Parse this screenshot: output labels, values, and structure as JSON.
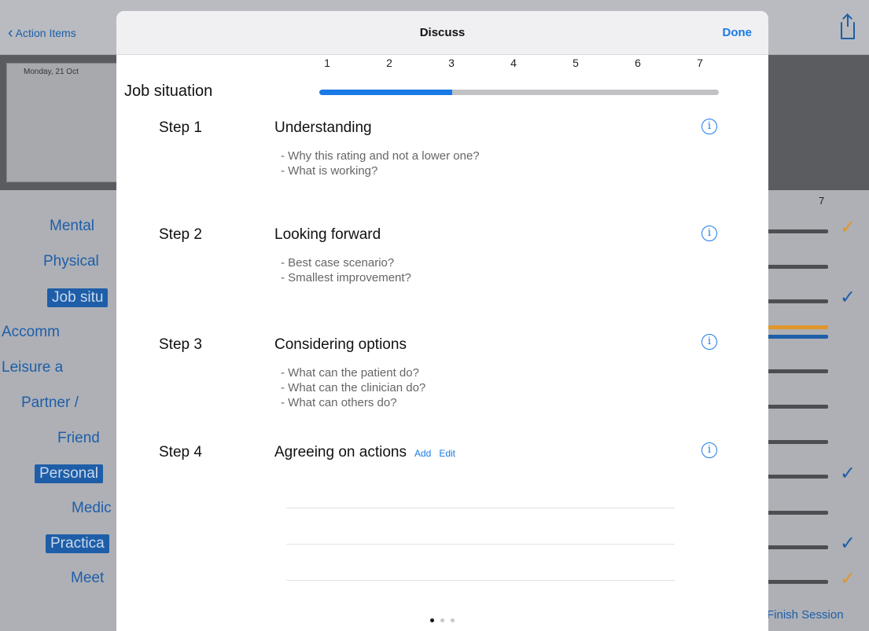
{
  "background": {
    "back_label": "Action Items",
    "date": "Monday, 21 Oct",
    "scale_top_label": "7",
    "finish_label": "Finish Session",
    "categories": [
      {
        "label": "Mental",
        "selected": false,
        "check": "orange"
      },
      {
        "label": "Physical",
        "selected": false,
        "check": "none"
      },
      {
        "label": "Job situ",
        "selected": true,
        "check": "blue"
      },
      {
        "label": "Accomm",
        "selected": false,
        "check": "none"
      },
      {
        "label": "Leisure a",
        "selected": false,
        "check": "none"
      },
      {
        "label": "Partner /",
        "selected": false,
        "check": "none"
      },
      {
        "label": "Friend",
        "selected": false,
        "check": "none"
      },
      {
        "label": "Personal",
        "selected": true,
        "check": "blue"
      },
      {
        "label": "Medic",
        "selected": false,
        "check": "none"
      },
      {
        "label": "Practica",
        "selected": true,
        "check": "blue"
      },
      {
        "label": "Meet",
        "selected": false,
        "check": "orange"
      }
    ],
    "colors": {
      "check_blue": "#1e5ea8",
      "check_orange": "#e0962a",
      "bar_orange": "#e0962a",
      "bar_blue": "#1e5ea8"
    }
  },
  "modal": {
    "title": "Discuss",
    "done_label": "Done",
    "scale": [
      "1",
      "2",
      "3",
      "4",
      "5",
      "6",
      "7"
    ],
    "item_label": "Job situation",
    "rating_value": 3,
    "rating_max": 7,
    "steps": [
      {
        "label": "Step 1",
        "title": "Understanding",
        "questions": [
          "- Why this rating and not a lower one?",
          "- What is working?"
        ]
      },
      {
        "label": "Step 2",
        "title": "Looking forward",
        "questions": [
          "- Best case scenario?",
          "- Smallest improvement?"
        ]
      },
      {
        "label": "Step 3",
        "title": "Considering options",
        "questions": [
          "- What can the patient do?",
          "- What can the clinician do?",
          "- What can others do?"
        ]
      },
      {
        "label": "Step 4",
        "title": "Agreeing on actions",
        "add_label": "Add",
        "edit_label": "Edit"
      }
    ],
    "info_icon_glyph": "i",
    "page_count": 3,
    "current_page": 1,
    "accent_color": "#1a7ae6"
  }
}
